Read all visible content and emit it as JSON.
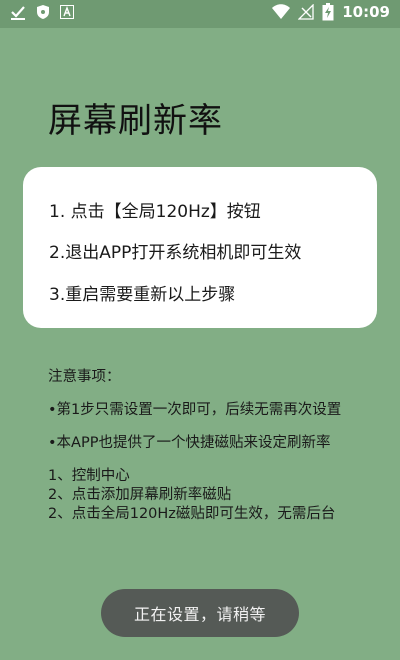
{
  "status_bar": {
    "time": "10:09",
    "icons": [
      "check-notification-icon",
      "shield-icon",
      "text-app-icon",
      "wifi-icon",
      "signal-icon",
      "battery-icon"
    ]
  },
  "page": {
    "title": "屏幕刷新率"
  },
  "instructions": {
    "steps": [
      "1. 点击【全局120Hz】按钮",
      "2.退出APP打开系统相机即可生效",
      "3.重启需要重新以上步骤"
    ]
  },
  "notes": {
    "title": "注意事项：",
    "bullets": [
      "•第1步只需设置一次即可，后续无需再次设置",
      "•本APP也提供了一个快捷磁贴来设定刷新率"
    ],
    "tips": [
      "1、控制中心",
      "2、点击添加屏幕刷新率磁贴",
      "2、点击全局120Hz磁贴即可生效，无需后台"
    ]
  },
  "toast": {
    "message": "正在设置，请稍等"
  },
  "colors": {
    "background": "#82ae85",
    "status_bar": "#6f9a72",
    "card": "#ffffff",
    "toast": "#555a56"
  }
}
